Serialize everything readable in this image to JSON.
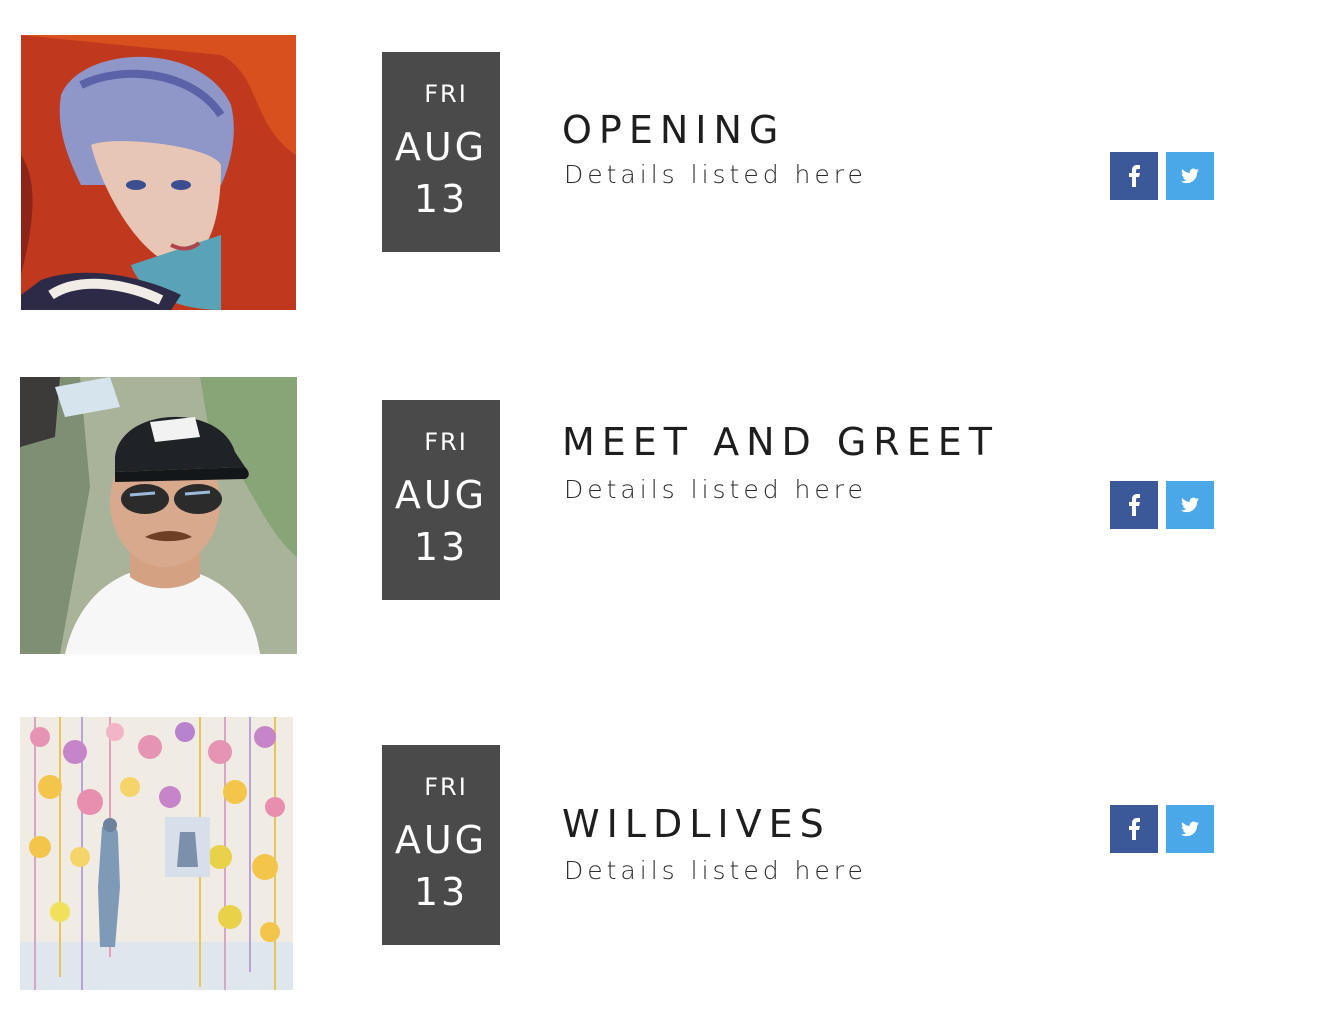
{
  "events": [
    {
      "title": "OPENING",
      "details": "Details listed here",
      "date": {
        "weekday": "FRI",
        "month": "AUG",
        "day": "13"
      },
      "image": "painted-child-portrait"
    },
    {
      "title": "MEET AND GREET",
      "details": "Details listed here",
      "date": {
        "weekday": "FRI",
        "month": "AUG",
        "day": "13"
      },
      "image": "man-in-cap-and-sunglasses"
    },
    {
      "title": "WILDLIVES",
      "details": "Details listed here",
      "date": {
        "weekday": "FRI",
        "month": "AUG",
        "day": "13"
      },
      "image": "butterflies-artwork"
    }
  ],
  "share": {
    "facebook_icon": "facebook-icon",
    "twitter_icon": "twitter-icon",
    "facebook_color": "#3b5998",
    "twitter_color": "#4aa8e8"
  },
  "colors": {
    "date_box": "#4a4a4a",
    "title_text": "#1e1e1e"
  }
}
